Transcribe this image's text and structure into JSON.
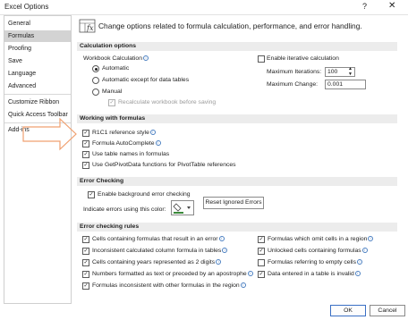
{
  "window": {
    "title": "Excel Options",
    "help": "?",
    "close": "✕"
  },
  "sidebar": {
    "items": [
      {
        "label": "General"
      },
      {
        "label": "Formulas"
      },
      {
        "label": "Proofing"
      },
      {
        "label": "Save"
      },
      {
        "label": "Language"
      },
      {
        "label": "Advanced"
      },
      {
        "label": "Customize Ribbon"
      },
      {
        "label": "Quick Access Toolbar"
      },
      {
        "label": "Add-ins"
      }
    ],
    "selected_index": 1
  },
  "header": {
    "text": "Change options related to formula calculation, performance, and error handling."
  },
  "calc": {
    "heading": "Calculation options",
    "workbook_label": "Workbook Calculation",
    "radio_automatic": "Automatic",
    "radio_auto_except": "Automatic except for data tables",
    "radio_manual": "Manual",
    "recalc_before_save": "Recalculate workbook before saving",
    "iterative_label": "Enable iterative calculation",
    "max_iter_label": "Maximum Iterations:",
    "max_iter_value": "100",
    "max_change_label": "Maximum Change:",
    "max_change_value": "0.001"
  },
  "working": {
    "heading": "Working with formulas",
    "r1c1": "R1C1 reference style",
    "autocomplete": "Formula AutoComplete",
    "table_names": "Use table names in formulas",
    "getpivot": "Use GetPivotData functions for PivotTable references"
  },
  "errcheck": {
    "heading": "Error Checking",
    "background": "Enable background error checking",
    "indicate_color": "Indicate errors using this color:",
    "reset_button": "Reset Ignored Errors"
  },
  "rules": {
    "heading": "Error checking rules",
    "left": [
      "Cells containing formulas that result in an error",
      "Inconsistent calculated column formula in tables",
      "Cells containing years represented as 2 digits",
      "Numbers formatted as text or preceded by an apostrophe",
      "Formulas inconsistent with other formulas in the region"
    ],
    "right": [
      "Formulas which omit cells in a region",
      "Unlocked cells containing formulas",
      "Formulas referring to empty cells",
      "Data entered in a table is invalid"
    ]
  },
  "footer": {
    "ok": "OK",
    "cancel": "Cancel"
  },
  "colors": {
    "selected_bg": "#d3d3d3",
    "heading_bg": "#ececec",
    "arrow": "#f0a070",
    "error_color": "#3a8a3a"
  }
}
